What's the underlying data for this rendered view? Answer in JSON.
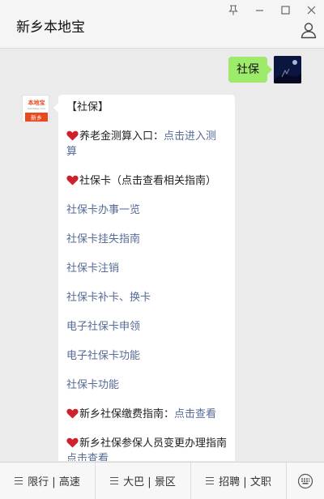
{
  "window": {
    "controls": [
      "pin",
      "minimize",
      "maximize",
      "close"
    ]
  },
  "header": {
    "title": "新乡本地宝"
  },
  "chat": {
    "outgoing": {
      "text": "社保"
    },
    "incoming": {
      "avatar_top_text": "本地宝",
      "avatar_mid_text": "bendibao.com",
      "avatar_bottom_text": "新乡",
      "lines": [
        {
          "type": "text",
          "text": "【社保】"
        },
        {
          "type": "heart-mixed",
          "prefix": "养老金测算入口：",
          "link": "点击进入测算"
        },
        {
          "type": "heart-text",
          "text": "社保卡（点击查看相关指南）"
        },
        {
          "type": "link",
          "text": "社保卡办事一览"
        },
        {
          "type": "link",
          "text": "社保卡挂失指南"
        },
        {
          "type": "link",
          "text": "社保卡注销"
        },
        {
          "type": "link",
          "text": "社保卡补卡、换卡"
        },
        {
          "type": "link",
          "text": "电子社保卡申领"
        },
        {
          "type": "link",
          "text": "电子社保卡功能"
        },
        {
          "type": "link",
          "text": "社保卡功能"
        },
        {
          "type": "heart-mixed",
          "prefix": "新乡社保缴费指南：",
          "link": "点击查看"
        },
        {
          "type": "heart-text",
          "text": "新乡社保参保人员变更办理指南"
        },
        {
          "type": "link",
          "text": "点击查看"
        }
      ]
    }
  },
  "bottom_menu": {
    "items": [
      "限行 | 高速",
      "大巴 | 景区",
      "招聘 | 文职"
    ]
  },
  "colors": {
    "outgoing_bubble": "#9eea6a",
    "link": "#576b95",
    "heart": "#d0202b",
    "avatar_brand": "#e8491d"
  }
}
